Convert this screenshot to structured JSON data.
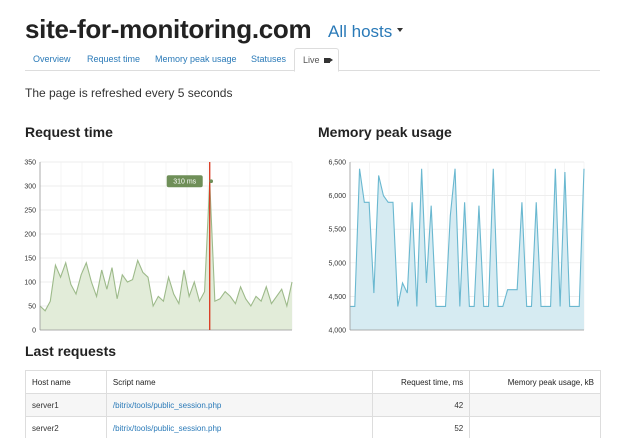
{
  "header": {
    "site_title": "site-for-monitoring.com",
    "hosts_label": "All hosts"
  },
  "tabs": [
    {
      "label": "Overview",
      "active": false
    },
    {
      "label": "Request time",
      "active": false
    },
    {
      "label": "Memory peak usage",
      "active": false
    },
    {
      "label": "Statuses",
      "active": false
    },
    {
      "label": "Live",
      "active": true
    }
  ],
  "refresh_text": "The page is refreshed every 5 seconds",
  "charts": {
    "request_title": "Request time",
    "memory_title": "Memory peak usage"
  },
  "chart_data": [
    {
      "type": "area",
      "title": "Request time",
      "xlabel": "",
      "ylabel": "",
      "ylim": [
        0,
        350
      ],
      "yticks": [
        0,
        50,
        100,
        150,
        200,
        250,
        300,
        350
      ],
      "grid": true,
      "color": "#9dba8a",
      "fill": "#e2ecd9",
      "marker_color": "#d9341c",
      "tooltip": {
        "label": "310 ms",
        "index": 33,
        "value": 310
      },
      "values": [
        50,
        40,
        60,
        135,
        110,
        140,
        95,
        75,
        115,
        140,
        100,
        70,
        125,
        85,
        130,
        65,
        115,
        100,
        105,
        145,
        120,
        110,
        50,
        70,
        60,
        110,
        75,
        55,
        125,
        70,
        100,
        60,
        80,
        310,
        60,
        65,
        80,
        70,
        55,
        90,
        65,
        50,
        70,
        60,
        90,
        55,
        70,
        85,
        50,
        100
      ]
    },
    {
      "type": "area",
      "title": "Memory peak usage",
      "xlabel": "",
      "ylabel": "",
      "ylim": [
        4000,
        6500
      ],
      "yticks": [
        4000,
        4500,
        5000,
        5500,
        6000,
        6500
      ],
      "ytick_labels": [
        "4,000",
        "4,500",
        "5,000",
        "5,500",
        "6,000",
        "6,500"
      ],
      "grid": true,
      "color": "#6ab8d0",
      "fill": "#d6ebf2",
      "values": [
        4350,
        4350,
        6400,
        5900,
        5900,
        4550,
        6300,
        6000,
        5900,
        5900,
        4350,
        4700,
        4550,
        5900,
        4350,
        6400,
        4700,
        5850,
        4350,
        4350,
        4350,
        5700,
        6400,
        4350,
        5900,
        4350,
        4350,
        5850,
        4350,
        4350,
        6400,
        4350,
        4350,
        4600,
        4600,
        4600,
        5900,
        4350,
        4350,
        5900,
        4350,
        4350,
        4350,
        6400,
        4350,
        6350,
        4350,
        4350,
        4350,
        6400
      ]
    }
  ],
  "last_requests": {
    "title": "Last requests",
    "columns": [
      "Host name",
      "Script name",
      "Request time, ms",
      "Memory peak usage, kB"
    ],
    "rows": [
      {
        "host": "server1",
        "script": "/bitrix/tools/public_session.php",
        "time": "42",
        "memory": ""
      },
      {
        "host": "server2",
        "script": "/bitrix/tools/public_session.php",
        "time": "52",
        "memory": ""
      }
    ]
  }
}
